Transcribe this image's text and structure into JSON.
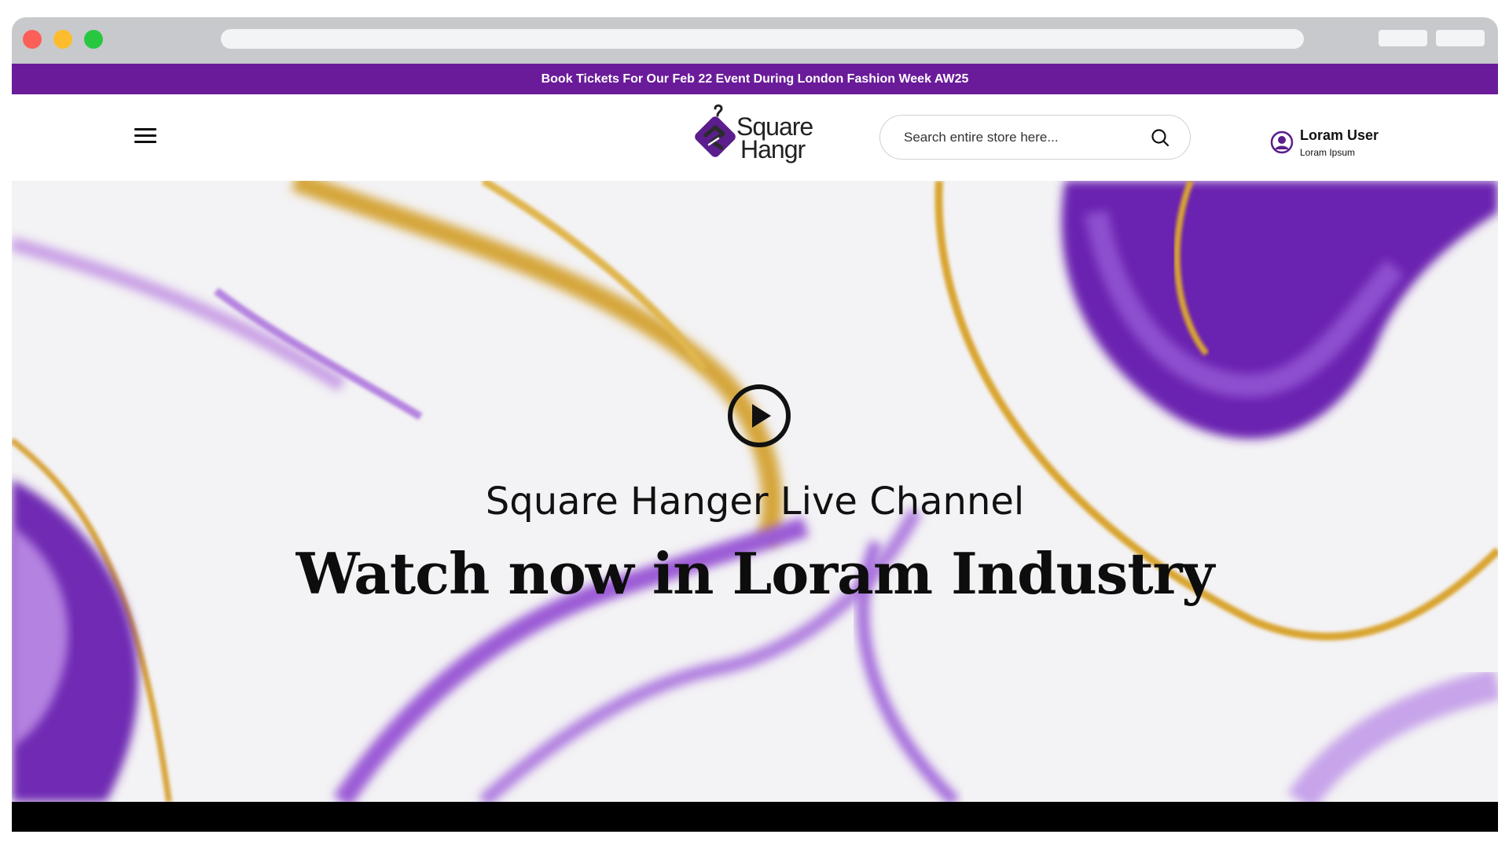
{
  "announcement": {
    "text": "Book Tickets For Our Feb 22 Event During London Fashion Week AW25",
    "background": "#6a1b9a"
  },
  "header": {
    "menu_icon": "hamburger-menu-icon",
    "logo": {
      "line1": "Square",
      "line2": "Hangr",
      "icon": "hanger-logo-icon"
    },
    "search": {
      "placeholder": "Search entire store here...",
      "value": "",
      "icon": "search-icon"
    },
    "user": {
      "name": "Loram User",
      "subtitle": "Loram Ipsum",
      "icon": "user-circle-icon"
    }
  },
  "hero": {
    "play_icon": "play-circle-icon",
    "subtitle": "Square Hanger Live Channel",
    "title": "Watch now in Loram Industry"
  },
  "colors": {
    "brand_purple": "#6a1b9a",
    "gold": "#d7a531",
    "text_dark": "#111111"
  }
}
